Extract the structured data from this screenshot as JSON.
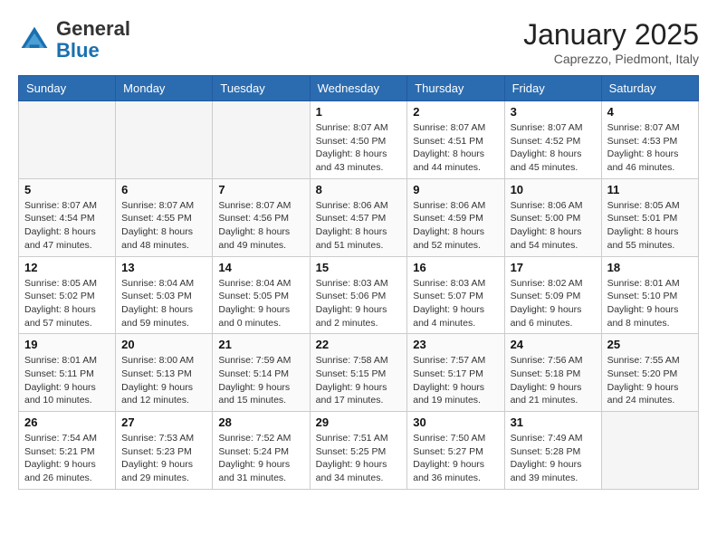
{
  "header": {
    "logo_general": "General",
    "logo_blue": "Blue",
    "month_title": "January 2025",
    "location": "Caprezzo, Piedmont, Italy"
  },
  "days_of_week": [
    "Sunday",
    "Monday",
    "Tuesday",
    "Wednesday",
    "Thursday",
    "Friday",
    "Saturday"
  ],
  "weeks": [
    [
      {
        "num": "",
        "info": ""
      },
      {
        "num": "",
        "info": ""
      },
      {
        "num": "",
        "info": ""
      },
      {
        "num": "1",
        "info": "Sunrise: 8:07 AM\nSunset: 4:50 PM\nDaylight: 8 hours\nand 43 minutes."
      },
      {
        "num": "2",
        "info": "Sunrise: 8:07 AM\nSunset: 4:51 PM\nDaylight: 8 hours\nand 44 minutes."
      },
      {
        "num": "3",
        "info": "Sunrise: 8:07 AM\nSunset: 4:52 PM\nDaylight: 8 hours\nand 45 minutes."
      },
      {
        "num": "4",
        "info": "Sunrise: 8:07 AM\nSunset: 4:53 PM\nDaylight: 8 hours\nand 46 minutes."
      }
    ],
    [
      {
        "num": "5",
        "info": "Sunrise: 8:07 AM\nSunset: 4:54 PM\nDaylight: 8 hours\nand 47 minutes."
      },
      {
        "num": "6",
        "info": "Sunrise: 8:07 AM\nSunset: 4:55 PM\nDaylight: 8 hours\nand 48 minutes."
      },
      {
        "num": "7",
        "info": "Sunrise: 8:07 AM\nSunset: 4:56 PM\nDaylight: 8 hours\nand 49 minutes."
      },
      {
        "num": "8",
        "info": "Sunrise: 8:06 AM\nSunset: 4:57 PM\nDaylight: 8 hours\nand 51 minutes."
      },
      {
        "num": "9",
        "info": "Sunrise: 8:06 AM\nSunset: 4:59 PM\nDaylight: 8 hours\nand 52 minutes."
      },
      {
        "num": "10",
        "info": "Sunrise: 8:06 AM\nSunset: 5:00 PM\nDaylight: 8 hours\nand 54 minutes."
      },
      {
        "num": "11",
        "info": "Sunrise: 8:05 AM\nSunset: 5:01 PM\nDaylight: 8 hours\nand 55 minutes."
      }
    ],
    [
      {
        "num": "12",
        "info": "Sunrise: 8:05 AM\nSunset: 5:02 PM\nDaylight: 8 hours\nand 57 minutes."
      },
      {
        "num": "13",
        "info": "Sunrise: 8:04 AM\nSunset: 5:03 PM\nDaylight: 8 hours\nand 59 minutes."
      },
      {
        "num": "14",
        "info": "Sunrise: 8:04 AM\nSunset: 5:05 PM\nDaylight: 9 hours\nand 0 minutes."
      },
      {
        "num": "15",
        "info": "Sunrise: 8:03 AM\nSunset: 5:06 PM\nDaylight: 9 hours\nand 2 minutes."
      },
      {
        "num": "16",
        "info": "Sunrise: 8:03 AM\nSunset: 5:07 PM\nDaylight: 9 hours\nand 4 minutes."
      },
      {
        "num": "17",
        "info": "Sunrise: 8:02 AM\nSunset: 5:09 PM\nDaylight: 9 hours\nand 6 minutes."
      },
      {
        "num": "18",
        "info": "Sunrise: 8:01 AM\nSunset: 5:10 PM\nDaylight: 9 hours\nand 8 minutes."
      }
    ],
    [
      {
        "num": "19",
        "info": "Sunrise: 8:01 AM\nSunset: 5:11 PM\nDaylight: 9 hours\nand 10 minutes."
      },
      {
        "num": "20",
        "info": "Sunrise: 8:00 AM\nSunset: 5:13 PM\nDaylight: 9 hours\nand 12 minutes."
      },
      {
        "num": "21",
        "info": "Sunrise: 7:59 AM\nSunset: 5:14 PM\nDaylight: 9 hours\nand 15 minutes."
      },
      {
        "num": "22",
        "info": "Sunrise: 7:58 AM\nSunset: 5:15 PM\nDaylight: 9 hours\nand 17 minutes."
      },
      {
        "num": "23",
        "info": "Sunrise: 7:57 AM\nSunset: 5:17 PM\nDaylight: 9 hours\nand 19 minutes."
      },
      {
        "num": "24",
        "info": "Sunrise: 7:56 AM\nSunset: 5:18 PM\nDaylight: 9 hours\nand 21 minutes."
      },
      {
        "num": "25",
        "info": "Sunrise: 7:55 AM\nSunset: 5:20 PM\nDaylight: 9 hours\nand 24 minutes."
      }
    ],
    [
      {
        "num": "26",
        "info": "Sunrise: 7:54 AM\nSunset: 5:21 PM\nDaylight: 9 hours\nand 26 minutes."
      },
      {
        "num": "27",
        "info": "Sunrise: 7:53 AM\nSunset: 5:23 PM\nDaylight: 9 hours\nand 29 minutes."
      },
      {
        "num": "28",
        "info": "Sunrise: 7:52 AM\nSunset: 5:24 PM\nDaylight: 9 hours\nand 31 minutes."
      },
      {
        "num": "29",
        "info": "Sunrise: 7:51 AM\nSunset: 5:25 PM\nDaylight: 9 hours\nand 34 minutes."
      },
      {
        "num": "30",
        "info": "Sunrise: 7:50 AM\nSunset: 5:27 PM\nDaylight: 9 hours\nand 36 minutes."
      },
      {
        "num": "31",
        "info": "Sunrise: 7:49 AM\nSunset: 5:28 PM\nDaylight: 9 hours\nand 39 minutes."
      },
      {
        "num": "",
        "info": ""
      }
    ]
  ]
}
